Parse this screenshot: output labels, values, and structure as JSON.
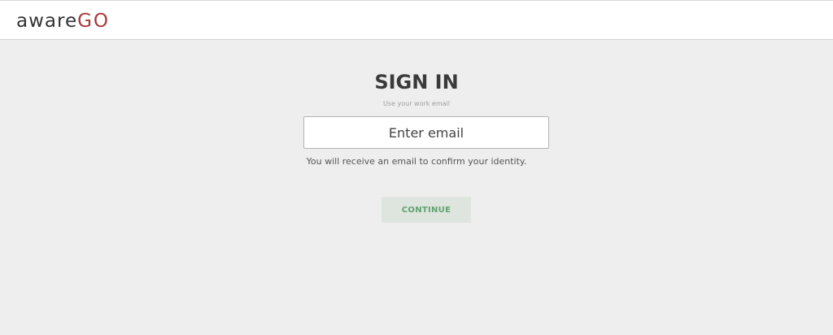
{
  "header": {
    "logo_part1": "aware",
    "logo_part2": "GO"
  },
  "signin": {
    "title": "SIGN IN",
    "hint": "Use your work email",
    "email_placeholder": "Enter email",
    "email_value": "",
    "note": "You will receive an email to confirm your identity.",
    "continue_label": "CONTINUE"
  },
  "colors": {
    "background": "#eeeeee",
    "header_bg": "#ffffff",
    "brand_red": "#a63a3c",
    "button_bg": "#dee4de",
    "button_text": "#5fa36f"
  }
}
